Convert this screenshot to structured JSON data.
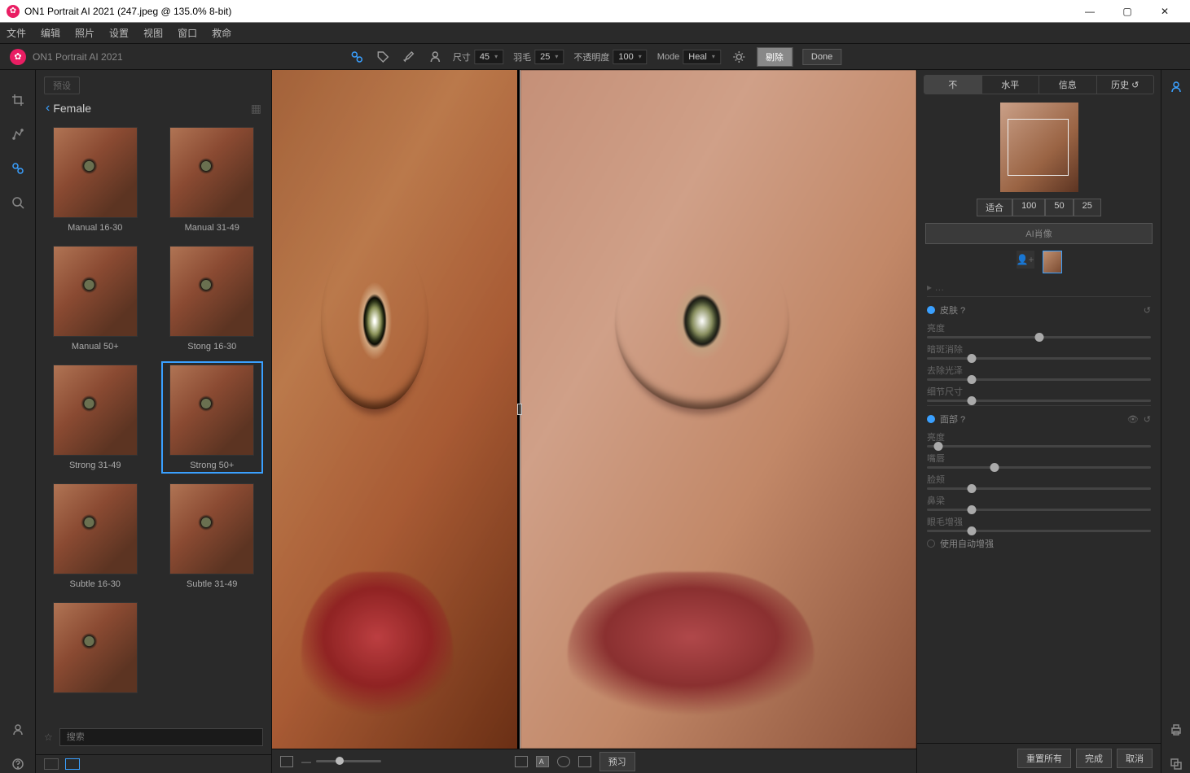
{
  "titlebar": {
    "app": "ON1 Portrait AI 2021",
    "doc": "(247.jpeg @ 135.0% 8-bit)"
  },
  "menubar": [
    "文件",
    "编辑",
    "照片",
    "设置",
    "视图",
    "窗口",
    "救命"
  ],
  "appLabel": "ON1 Portrait AI 2021",
  "toolbar": {
    "size": {
      "label": "尺寸",
      "value": "45"
    },
    "feather": {
      "label": "羽毛",
      "value": "25"
    },
    "opacity": {
      "label": "不透明度",
      "value": "100"
    },
    "mode": {
      "label": "Mode",
      "value": "Heal"
    },
    "clear": "剔除",
    "done": "Done"
  },
  "reset_chip": "预设",
  "presets": {
    "category": "Female",
    "items": [
      {
        "label": "Manual 16-30"
      },
      {
        "label": "Manual 31-49"
      },
      {
        "label": "Manual 50+"
      },
      {
        "label": "Stong 16-30"
      },
      {
        "label": "Strong 31-49"
      },
      {
        "label": "Strong 50+",
        "selected": true
      },
      {
        "label": "Subtle 16-30"
      },
      {
        "label": "Subtle 31-49"
      },
      {
        "label": ""
      }
    ],
    "search_placeholder": "搜索"
  },
  "canvasFooter": {
    "preview": "预习"
  },
  "panel": {
    "tabs": [
      "不",
      "水平",
      "信息",
      "历史 ↺"
    ],
    "zoomButtons": [
      "适合",
      "100",
      "50",
      "25"
    ],
    "aiBtn": "AI肖像",
    "section1": {
      "title": "皮肤 ?",
      "sliders": [
        {
          "label": "亮度",
          "pos": 50
        },
        {
          "label": "暗斑消除",
          "pos": 20
        },
        {
          "label": "去除光泽",
          "pos": 20
        },
        {
          "label": "细节尺寸",
          "pos": 20
        }
      ]
    },
    "section2": {
      "title": "面部 ?",
      "sliders": [
        {
          "label": "亮度",
          "pos": 5
        },
        {
          "label": "嘴唇",
          "pos": 30
        },
        {
          "label": "脸颊",
          "pos": 20
        },
        {
          "label": "鼻梁",
          "pos": 20
        },
        {
          "label": "眼毛增强",
          "pos": 20
        }
      ],
      "extra": "使用自动增强"
    },
    "footer": {
      "resetAll": "重置所有",
      "done": "完成",
      "cancel": "取消"
    }
  }
}
